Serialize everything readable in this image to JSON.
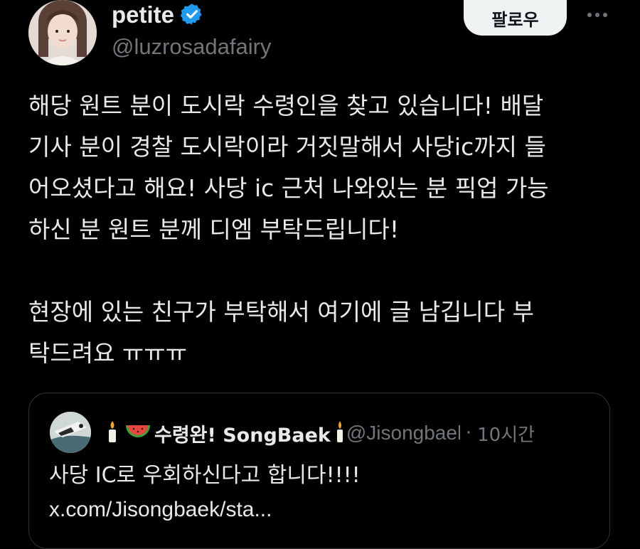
{
  "author": {
    "display_name": "petite",
    "handle": "@luzrosadafairy",
    "verified": true,
    "verified_color": "#1d9bf0"
  },
  "follow_button": {
    "label": "팔로우"
  },
  "more_icon": "more-horizontal-icon",
  "tweet": {
    "paragraph1_lines": [
      "해당 원트 분이 도시락 수령인을 찾고 있습니다! 배달",
      "기사 분이 경찰 도시락이라 거짓말해서 사당ic까지 들",
      "어오셨다고 해요! 사당 ic 근처 나와있는 분 픽업 가능",
      "하신 분 원트 분께 디엠 부탁드립니다!"
    ],
    "paragraph2_lines": [
      "현장에 있는 친구가 부탁해서 여기에 글 남깁니다 부",
      "탁드려요 ㅠㅠㅠ"
    ]
  },
  "quote": {
    "display_name": "수령완! SongBaek",
    "handle": "@Jisongbaek",
    "separator": "·",
    "time": "10시간",
    "icons": [
      "candle-icon",
      "watermelon-icon",
      "candle-icon"
    ],
    "text_line1": "사당 IC로 우회하신다고 합니다!!!!",
    "text_line2": "x.com/Jisongbaek/sta..."
  },
  "colors": {
    "background": "#000000",
    "text_primary": "#e7e9ea",
    "text_secondary": "#71767b",
    "border": "#2f3336",
    "button_bg": "#eff3f4"
  }
}
